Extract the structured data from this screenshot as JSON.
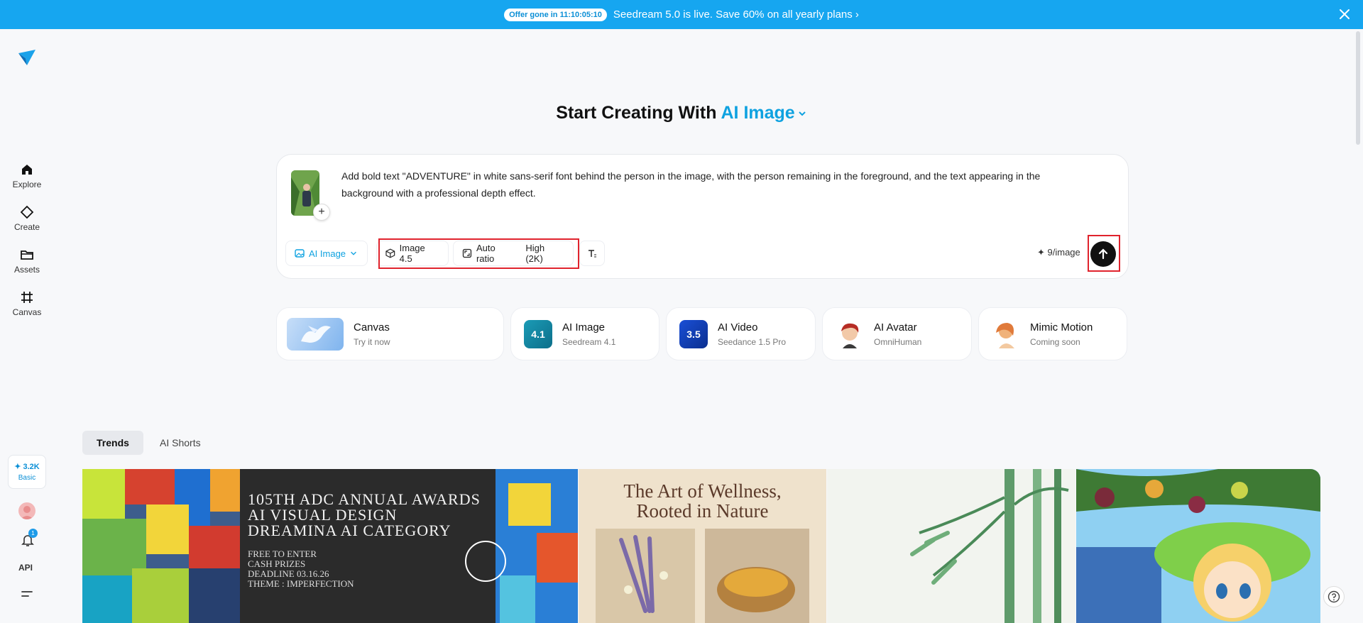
{
  "banner": {
    "offer": "Offer gone in 11:10:05:10",
    "text": "Seedream 5.0 is live. Save 60% on all yearly plans ›"
  },
  "sidebar": {
    "items": [
      {
        "label": "Explore",
        "icon": "home-icon"
      },
      {
        "label": "Create",
        "icon": "diamond-icon"
      },
      {
        "label": "Assets",
        "icon": "folder-icon"
      },
      {
        "label": "Canvas",
        "icon": "canvas-icon"
      }
    ],
    "credits": "✦ 3.2K",
    "plan": "Basic",
    "notifications": "1",
    "api": "API"
  },
  "heading": {
    "prefix": "Start Creating With ",
    "accent": "AI Image"
  },
  "prompt": {
    "text": "Add bold text \"ADVENTURE\" in white sans-serif font behind the person in the image, with the person remaining in the foreground, and the text appearing in the background with a professional depth effect.",
    "add": "+"
  },
  "toolbar": {
    "mode": "AI Image",
    "model": "Image 4.5",
    "ratio": "Auto ratio",
    "quality": "High (2K)",
    "cost": "✦ 9/image"
  },
  "features": [
    {
      "title": "Canvas",
      "sub": "Try it now"
    },
    {
      "title": "AI Image",
      "sub": "Seedream 4.1",
      "badge": "4.1"
    },
    {
      "title": "AI Video",
      "sub": "Seedance 1.5 Pro",
      "badge": "3.5"
    },
    {
      "title": "AI Avatar",
      "sub": "OmniHuman"
    },
    {
      "title": "Mimic Motion",
      "sub": "Coming soon"
    }
  ],
  "tabs": [
    "Trends",
    "AI Shorts"
  ],
  "gallery": {
    "adc": {
      "line1": "105TH ADC ANNUAL AWARDS",
      "line2": "AI VISUAL DESIGN",
      "line3": "DREAMINA AI CATEGORY",
      "detail1": "FREE TO ENTER",
      "detail2": "CASH PRIZES",
      "detail3": "DEADLINE 03.16.26",
      "detail4": "THEME : IMPERFECTION"
    },
    "wellness": {
      "line1": "The Art of Wellness,",
      "line2": "Rooted in Nature"
    }
  },
  "colors": {
    "banner": "#16a6f0",
    "accent": "#0fa2e0",
    "highlight": "#e0232d"
  }
}
